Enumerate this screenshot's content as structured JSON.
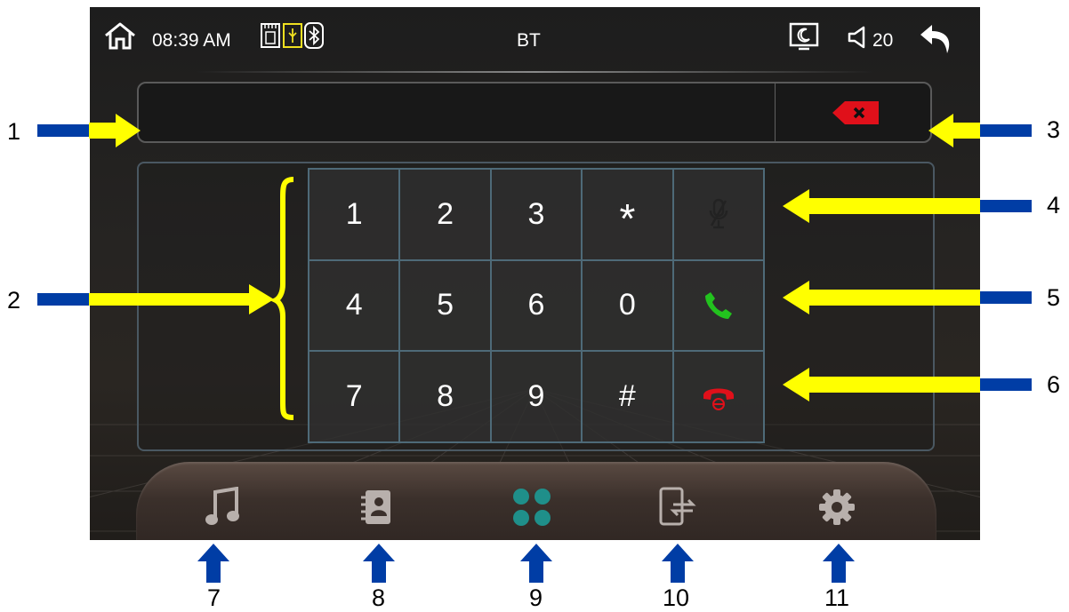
{
  "status_bar": {
    "time": "08:39 AM",
    "title": "BT",
    "volume": "20",
    "icons": [
      "home-icon",
      "sd-card-icon",
      "usb-icon",
      "bluetooth-icon",
      "night-mode-icon",
      "volume-icon",
      "back-icon"
    ]
  },
  "number_display": {
    "value": "",
    "backspace_icon": "backspace-icon",
    "backspace_color": "#e0101a"
  },
  "keypad": {
    "keys": [
      {
        "id": "1",
        "label": "1"
      },
      {
        "id": "2",
        "label": "2"
      },
      {
        "id": "3",
        "label": "3"
      },
      {
        "id": "star",
        "label": "*"
      },
      {
        "id": "mute",
        "label": "",
        "icon": "mic-mute-icon"
      },
      {
        "id": "4",
        "label": "4"
      },
      {
        "id": "5",
        "label": "5"
      },
      {
        "id": "6",
        "label": "6"
      },
      {
        "id": "0",
        "label": "0"
      },
      {
        "id": "call",
        "label": "",
        "icon": "call-icon"
      },
      {
        "id": "7",
        "label": "7"
      },
      {
        "id": "8",
        "label": "8"
      },
      {
        "id": "9",
        "label": "9"
      },
      {
        "id": "hash",
        "label": "#"
      },
      {
        "id": "hangup",
        "label": "",
        "icon": "hang-up-icon"
      }
    ],
    "call_color": "#22c21e",
    "hangup_color": "#e0101a"
  },
  "dock": {
    "items": [
      "music-icon",
      "contacts-icon",
      "dialpad-icon",
      "phone-transfer-icon",
      "settings-icon"
    ],
    "active_color": "#1f8f8a",
    "inactive_color": "#b8b0ac"
  },
  "annotations": {
    "labels": [
      "1",
      "2",
      "3",
      "4",
      "5",
      "6",
      "7",
      "8",
      "9",
      "10",
      "11"
    ],
    "arrow_color": "#ffff00",
    "bar_color": "#003da5"
  }
}
